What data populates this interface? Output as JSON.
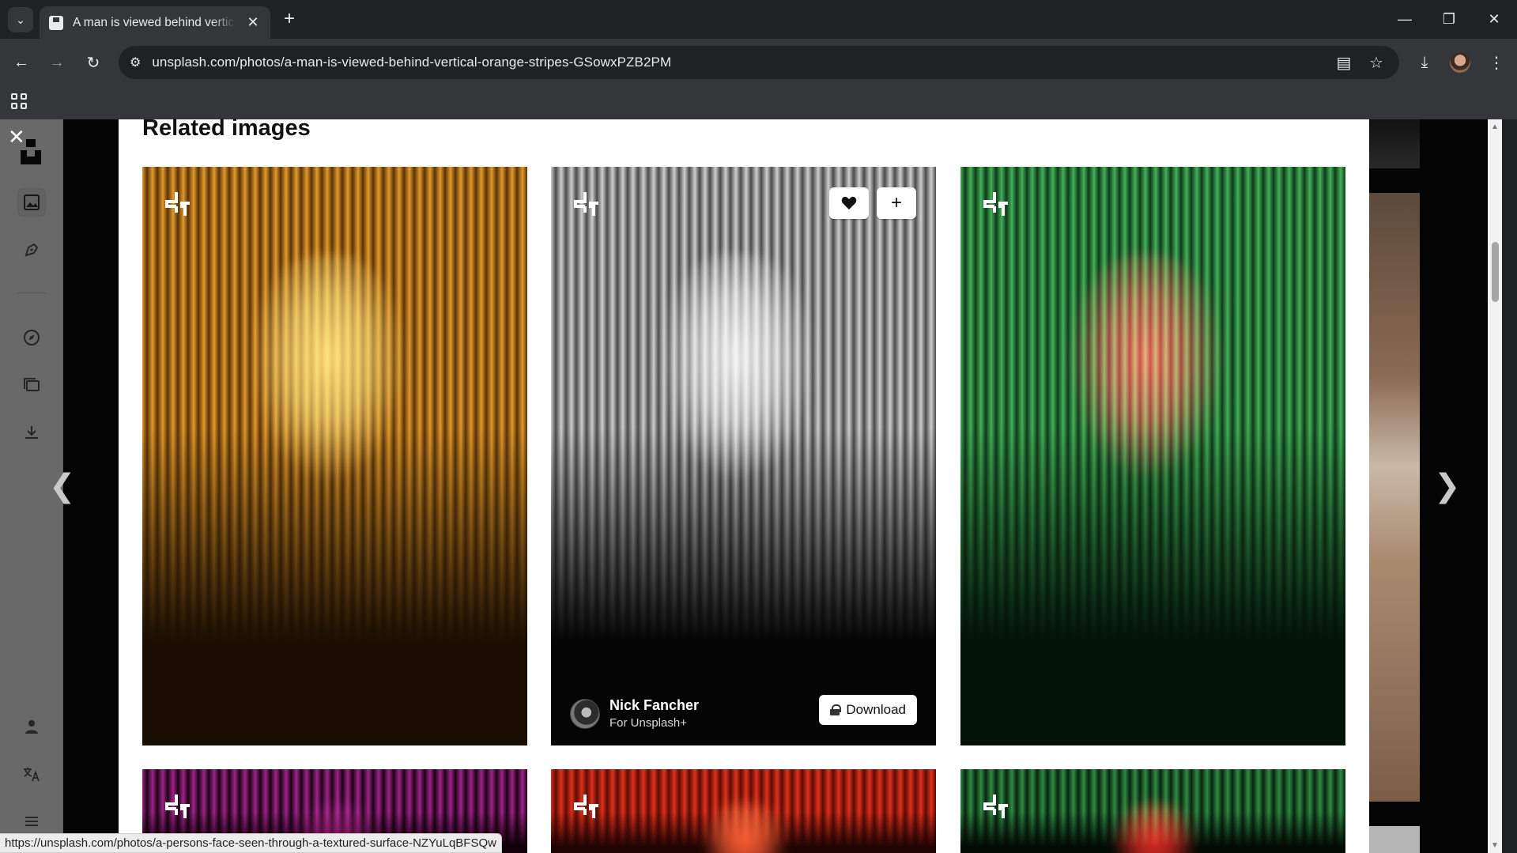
{
  "browser": {
    "tab_title": "A man is viewed behind vertical orange stripes",
    "url": "unsplash.com/photos/a-man-is-viewed-behind-vertical-orange-stripes-GSowxPZB2PM",
    "status_url": "https://unsplash.com/photos/a-persons-face-seen-through-a-textured-surface-NZYuLqBFSQw"
  },
  "page": {
    "section_title": "Related images"
  },
  "photos": [
    {
      "palette": "orange",
      "stripe_a": "#e29a2a",
      "stripe_b": "#5a3208",
      "face": "#f3c36a",
      "bottom": "#1a0e02"
    },
    {
      "palette": "grayscale",
      "stripe_a": "#cfcfcf",
      "stripe_b": "#4a4a4a",
      "face": "#d8d8d8",
      "bottom": "#050505",
      "hover": true,
      "author": "Nick Fancher",
      "author_sub": "For Unsplash+",
      "download_label": "Download"
    },
    {
      "palette": "green",
      "stripe_a": "#43b05a",
      "stripe_b": "#0e3a18",
      "face": "#e01e3a",
      "bottom": "#031207"
    },
    {
      "palette": "magenta",
      "stripe_a": "#a0228a",
      "stripe_b": "#1a0414",
      "face": "#5a1040",
      "bottom": "#100008"
    },
    {
      "palette": "red",
      "stripe_a": "#e0301c",
      "stripe_b": "#5a0c04",
      "face": "#ff5a30",
      "bottom": "#200402"
    },
    {
      "palette": "green-red",
      "stripe_a": "#2f8a45",
      "stripe_b": "#08240e",
      "face": "#e0201e",
      "bottom": "#020a04"
    }
  ],
  "colors": {
    "chrome_dark": "#202124",
    "chrome_mid": "#35363a",
    "rail_bg": "#e9e9e9"
  }
}
